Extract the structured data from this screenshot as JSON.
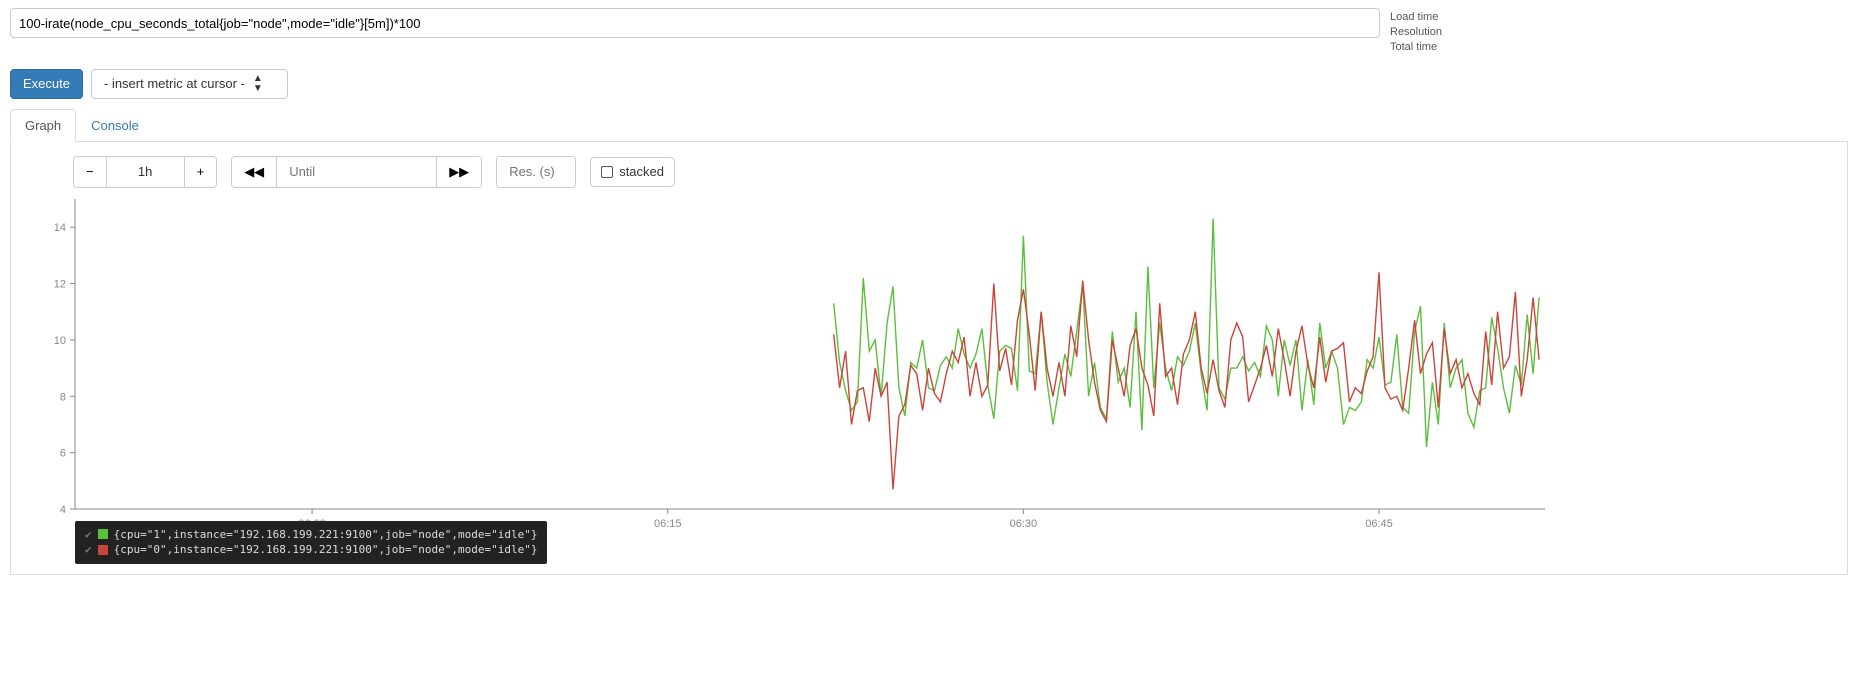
{
  "query": {
    "value": "100-irate(node_cpu_seconds_total{job=\"node\",mode=\"idle\"}[5m])*100"
  },
  "actions": {
    "execute_label": "Execute",
    "metric_select_label": "- insert metric at cursor -"
  },
  "stats": {
    "load_time": "Load time",
    "resolution": "Resolution",
    "total_time": "Total time"
  },
  "tabs": {
    "graph": "Graph",
    "console": "Console",
    "active": "graph"
  },
  "graph_toolbar": {
    "minus": "−",
    "range": "1h",
    "plus": "+",
    "back": "◀◀",
    "until_placeholder": "Until",
    "fwd": "▶▶",
    "res_placeholder": "Res. (s)",
    "stacked_label": "stacked"
  },
  "legend": {
    "series1": "{cpu=\"1\",instance=\"192.168.199.221:9100\",job=\"node\",mode=\"idle\"}",
    "series0": "{cpu=\"0\",instance=\"192.168.199.221:9100\",job=\"node\",mode=\"idle\"}"
  },
  "chart_data": {
    "type": "line",
    "xlabel": "",
    "ylabel": "",
    "ylim": [
      4,
      15
    ],
    "y_ticks": [
      4,
      6,
      8,
      10,
      12,
      14
    ],
    "x_ticks_labels": [
      "06:00",
      "06:15",
      "06:30",
      "06:45"
    ],
    "x_range_minutes": [
      -10,
      52
    ],
    "x_ticks_minutes": [
      0,
      15,
      30,
      45
    ],
    "x_data_start_minute": 22,
    "x_step_minutes": 0.25,
    "series": [
      {
        "name": "cpu1",
        "color": "#5bbf3c",
        "values": [
          11.3,
          9.2,
          8.2,
          7.5,
          7.8,
          12.2,
          9.6,
          10.0,
          8.0,
          10.6,
          11.9,
          8.3,
          7.3,
          9.2,
          9.0,
          10.0,
          8.3,
          8.2,
          9.1,
          9.4,
          9.0,
          10.4,
          9.5,
          9.0,
          9.5,
          10.4,
          8.4,
          7.2,
          9.6,
          9.8,
          9.7,
          8.2,
          13.7,
          8.9,
          8.8,
          11.0,
          8.5,
          7.0,
          8.3,
          9.5,
          8.7,
          10.3,
          12.0,
          8.0,
          9.2,
          7.6,
          7.2,
          10.3,
          8.5,
          9.0,
          7.6,
          11.0,
          6.8,
          12.6,
          8.3,
          10.6,
          9.0,
          8.2,
          9.4,
          9.1,
          9.6,
          10.6,
          8.8,
          7.5,
          14.3,
          8.3,
          7.9,
          9.0,
          9.0,
          9.4,
          8.9,
          9.2,
          8.7,
          10.5,
          10.0,
          8.0,
          10.0,
          9.1,
          10.0,
          7.5,
          9.3,
          7.7,
          10.6,
          9.0,
          9.6,
          9.0,
          7.0,
          7.6,
          7.5,
          7.8,
          9.3,
          9.0,
          10.1,
          8.4,
          8.5,
          10.2,
          7.6,
          7.4,
          10.3,
          11.2,
          6.2,
          8.5,
          7.0,
          10.6,
          8.3,
          9.0,
          9.3,
          7.4,
          6.9,
          8.2,
          8.3,
          10.8,
          9.7,
          8.3,
          7.4,
          9.1,
          8.4,
          10.9,
          8.8,
          11.5
        ]
      },
      {
        "name": "cpu0",
        "color": "#c9453b",
        "values": [
          10.2,
          8.3,
          9.6,
          7.0,
          8.2,
          8.3,
          7.1,
          9.0,
          8.0,
          8.5,
          4.7,
          7.3,
          7.7,
          9.1,
          8.8,
          7.5,
          9.0,
          8.1,
          7.8,
          8.8,
          9.6,
          9.2,
          10.1,
          8.0,
          9.2,
          8.0,
          8.4,
          12.0,
          8.9,
          9.7,
          8.4,
          10.7,
          11.8,
          10.2,
          8.2,
          11.0,
          9.0,
          8.0,
          9.2,
          8.0,
          10.5,
          9.4,
          12.1,
          10.0,
          8.5,
          7.5,
          7.1,
          10.0,
          9.0,
          8.0,
          9.8,
          10.4,
          9.0,
          8.4,
          7.3,
          11.3,
          8.7,
          9.0,
          7.7,
          9.5,
          10.0,
          11.0,
          9.0,
          8.1,
          9.3,
          8.2,
          7.6,
          10.0,
          10.6,
          10.1,
          7.8,
          8.4,
          9.0,
          9.8,
          8.7,
          10.4,
          9.3,
          8.0,
          9.6,
          10.5,
          9.1,
          8.3,
          10.1,
          8.5,
          9.6,
          9.7,
          9.9,
          7.8,
          8.3,
          8.1,
          8.9,
          9.4,
          12.4,
          8.3,
          7.9,
          8.0,
          7.5,
          9.0,
          10.7,
          8.8,
          9.5,
          9.9,
          7.6,
          10.4,
          8.8,
          9.3,
          8.3,
          8.8,
          8.1,
          7.7,
          10.3,
          8.4,
          11.0,
          9.0,
          9.4,
          11.7,
          8.0,
          9.3,
          11.5,
          9.3
        ]
      }
    ]
  }
}
